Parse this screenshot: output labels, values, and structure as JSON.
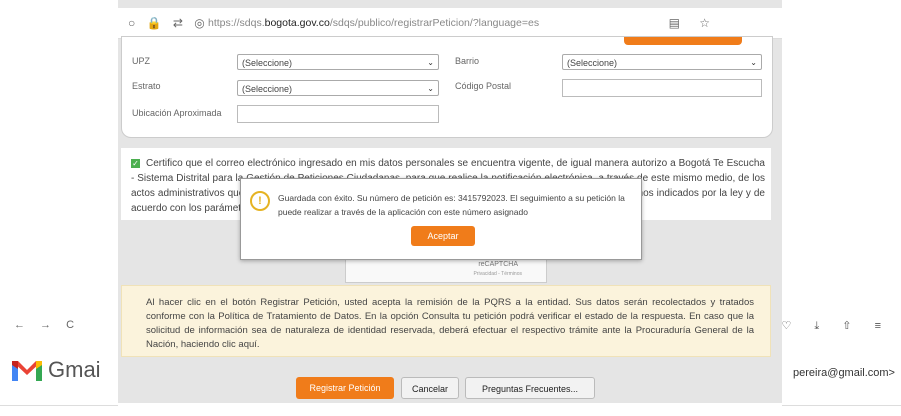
{
  "background": {
    "nav_icons": "← → C",
    "right_icons": "♡ ⤓ ⇧ ≡",
    "gmail_label": "Gmai",
    "email_fragment": "pereira@gmail.com>"
  },
  "browser": {
    "url_icons": "○ 🔒 ⇄ ◎",
    "url_prefix": "https://sdqs.",
    "url_domain": "bogota.gov.co",
    "url_suffix": "/sdqs/publico/registrarPeticion/?language=es",
    "url_right_icons": "▤ ☆"
  },
  "form": {
    "upz_label": "UPZ",
    "upz_value": "(Seleccione)",
    "barrio_label": "Barrio",
    "barrio_value": "(Seleccione)",
    "estrato_label": "Estrato",
    "estrato_value": "(Seleccione)",
    "postal_label": "Código Postal",
    "ubicacion_label": "Ubicación Aproximada"
  },
  "certification": {
    "checked": true,
    "text": "Certifico que el correo electrónico ingresado en mis datos personales se encuentra vigente, de igual manera autorizo a Bogotá Te Escucha - Sistema Distrital para la Gestión de Peticiones Ciudadanas, para que realice la notificación electrónica, a través de este mismo medio, de los actos administrativos que se expidan en el trámite de la petición, incluyendo la respuesta a la misma, en los términos indicados por la ley y de acuerdo con los parámetros que la Entidad establezca y disponga."
  },
  "captcha": {
    "brand": "reCAPTCHA",
    "links": "Privacidad - Términos"
  },
  "terms": {
    "text": "Al hacer clic en el botón Registrar Petición, usted acepta la remisión de la PQRS a la entidad. Sus datos serán recolectados y tratados conforme con la Política de Tratamiento de Datos. En la opción Consulta tu petición podrá verificar el estado de la respuesta. En caso que la solicitud de información sea de naturaleza de identidad reservada, deberá efectuar el respectivo trámite ante la Procuraduría General de la Nación, haciendo clic aquí."
  },
  "actions": {
    "register": "Registrar Petición",
    "cancel": "Cancelar",
    "faq": "Preguntas Frecuentes..."
  },
  "modal": {
    "icon": "!",
    "message": "Guardada con éxito. Su número de petición es: 3415792023. El seguimiento a su petición la puede realizar a través de la aplicación con este número asignado",
    "accept": "Aceptar"
  },
  "colors": {
    "accent": "#f07c1a",
    "warning": "#e5b323",
    "check": "#4caf50"
  }
}
